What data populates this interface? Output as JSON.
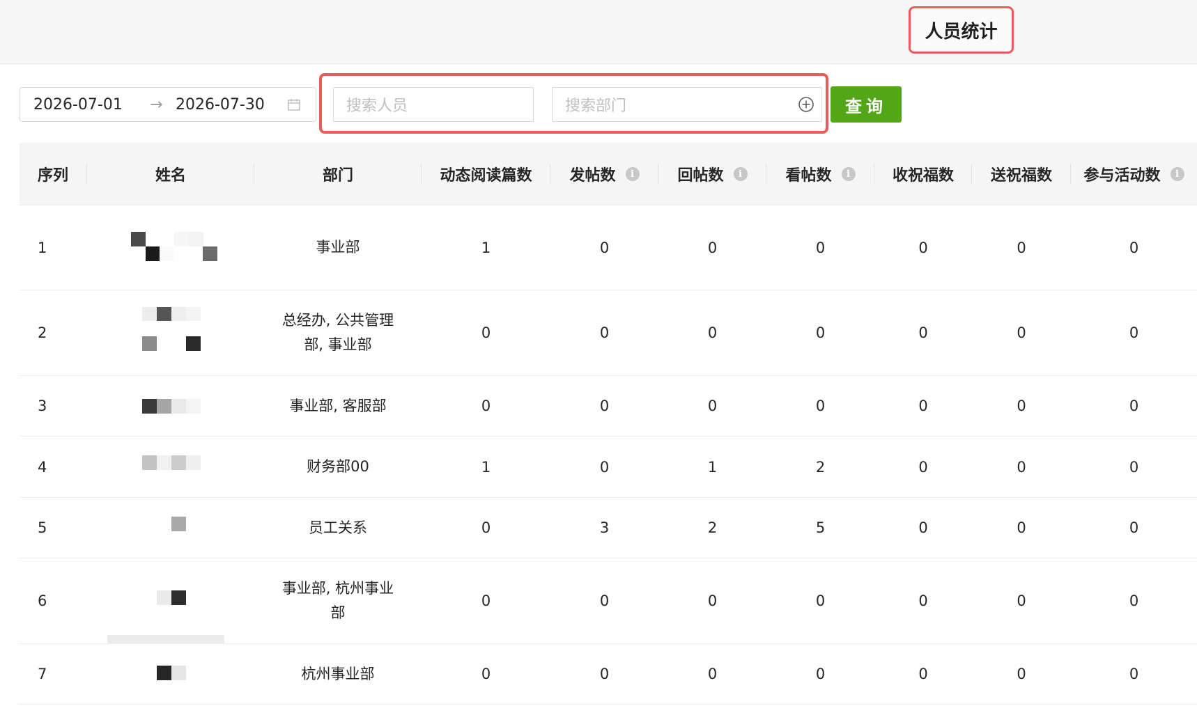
{
  "header": {
    "active_tab": "人员统计"
  },
  "filters": {
    "start_date": "2026-07-01",
    "arrow": "→",
    "end_date": "2026-07-30",
    "person_placeholder": "搜索人员",
    "dept_placeholder": "搜索部门",
    "query_label": "查询"
  },
  "table": {
    "columns": [
      {
        "label": "序列",
        "info": false
      },
      {
        "label": "姓名",
        "info": false
      },
      {
        "label": "部门",
        "info": false
      },
      {
        "label": "动态阅读篇数",
        "info": false
      },
      {
        "label": "发帖数",
        "info": true
      },
      {
        "label": "回帖数",
        "info": true
      },
      {
        "label": "看帖数",
        "info": true
      },
      {
        "label": "收祝福数",
        "info": false
      },
      {
        "label": "送祝福数",
        "info": false
      },
      {
        "label": "参与活动数",
        "info": true
      }
    ],
    "rows": [
      {
        "index": "1",
        "dept": "事业部",
        "read": "1",
        "post": "0",
        "reply": "0",
        "view": "0",
        "recv": "0",
        "send": "0",
        "act": "0"
      },
      {
        "index": "2",
        "dept": "总经办, 公共管理部, 事业部",
        "read": "0",
        "post": "0",
        "reply": "0",
        "view": "0",
        "recv": "0",
        "send": "0",
        "act": "0"
      },
      {
        "index": "3",
        "dept": "事业部, 客服部",
        "read": "0",
        "post": "0",
        "reply": "0",
        "view": "0",
        "recv": "0",
        "send": "0",
        "act": "0"
      },
      {
        "index": "4",
        "dept": "财务部00",
        "read": "1",
        "post": "0",
        "reply": "1",
        "view": "2",
        "recv": "0",
        "send": "0",
        "act": "0"
      },
      {
        "index": "5",
        "dept": "员工关系",
        "read": "0",
        "post": "3",
        "reply": "2",
        "view": "5",
        "recv": "0",
        "send": "0",
        "act": "0"
      },
      {
        "index": "6",
        "dept": "事业部, 杭州事业部",
        "read": "0",
        "post": "0",
        "reply": "0",
        "view": "0",
        "recv": "0",
        "send": "0",
        "act": "0"
      },
      {
        "index": "7",
        "dept": "杭州事业部",
        "read": "0",
        "post": "0",
        "reply": "0",
        "view": "0",
        "recv": "0",
        "send": "0",
        "act": "0"
      }
    ]
  },
  "icons": {
    "calendar": "calendar-icon",
    "plus": "plus-circle-icon",
    "info": "info-icon"
  },
  "colors": {
    "accent_green": "#52a617",
    "highlight_red": "#ee5a5a"
  }
}
